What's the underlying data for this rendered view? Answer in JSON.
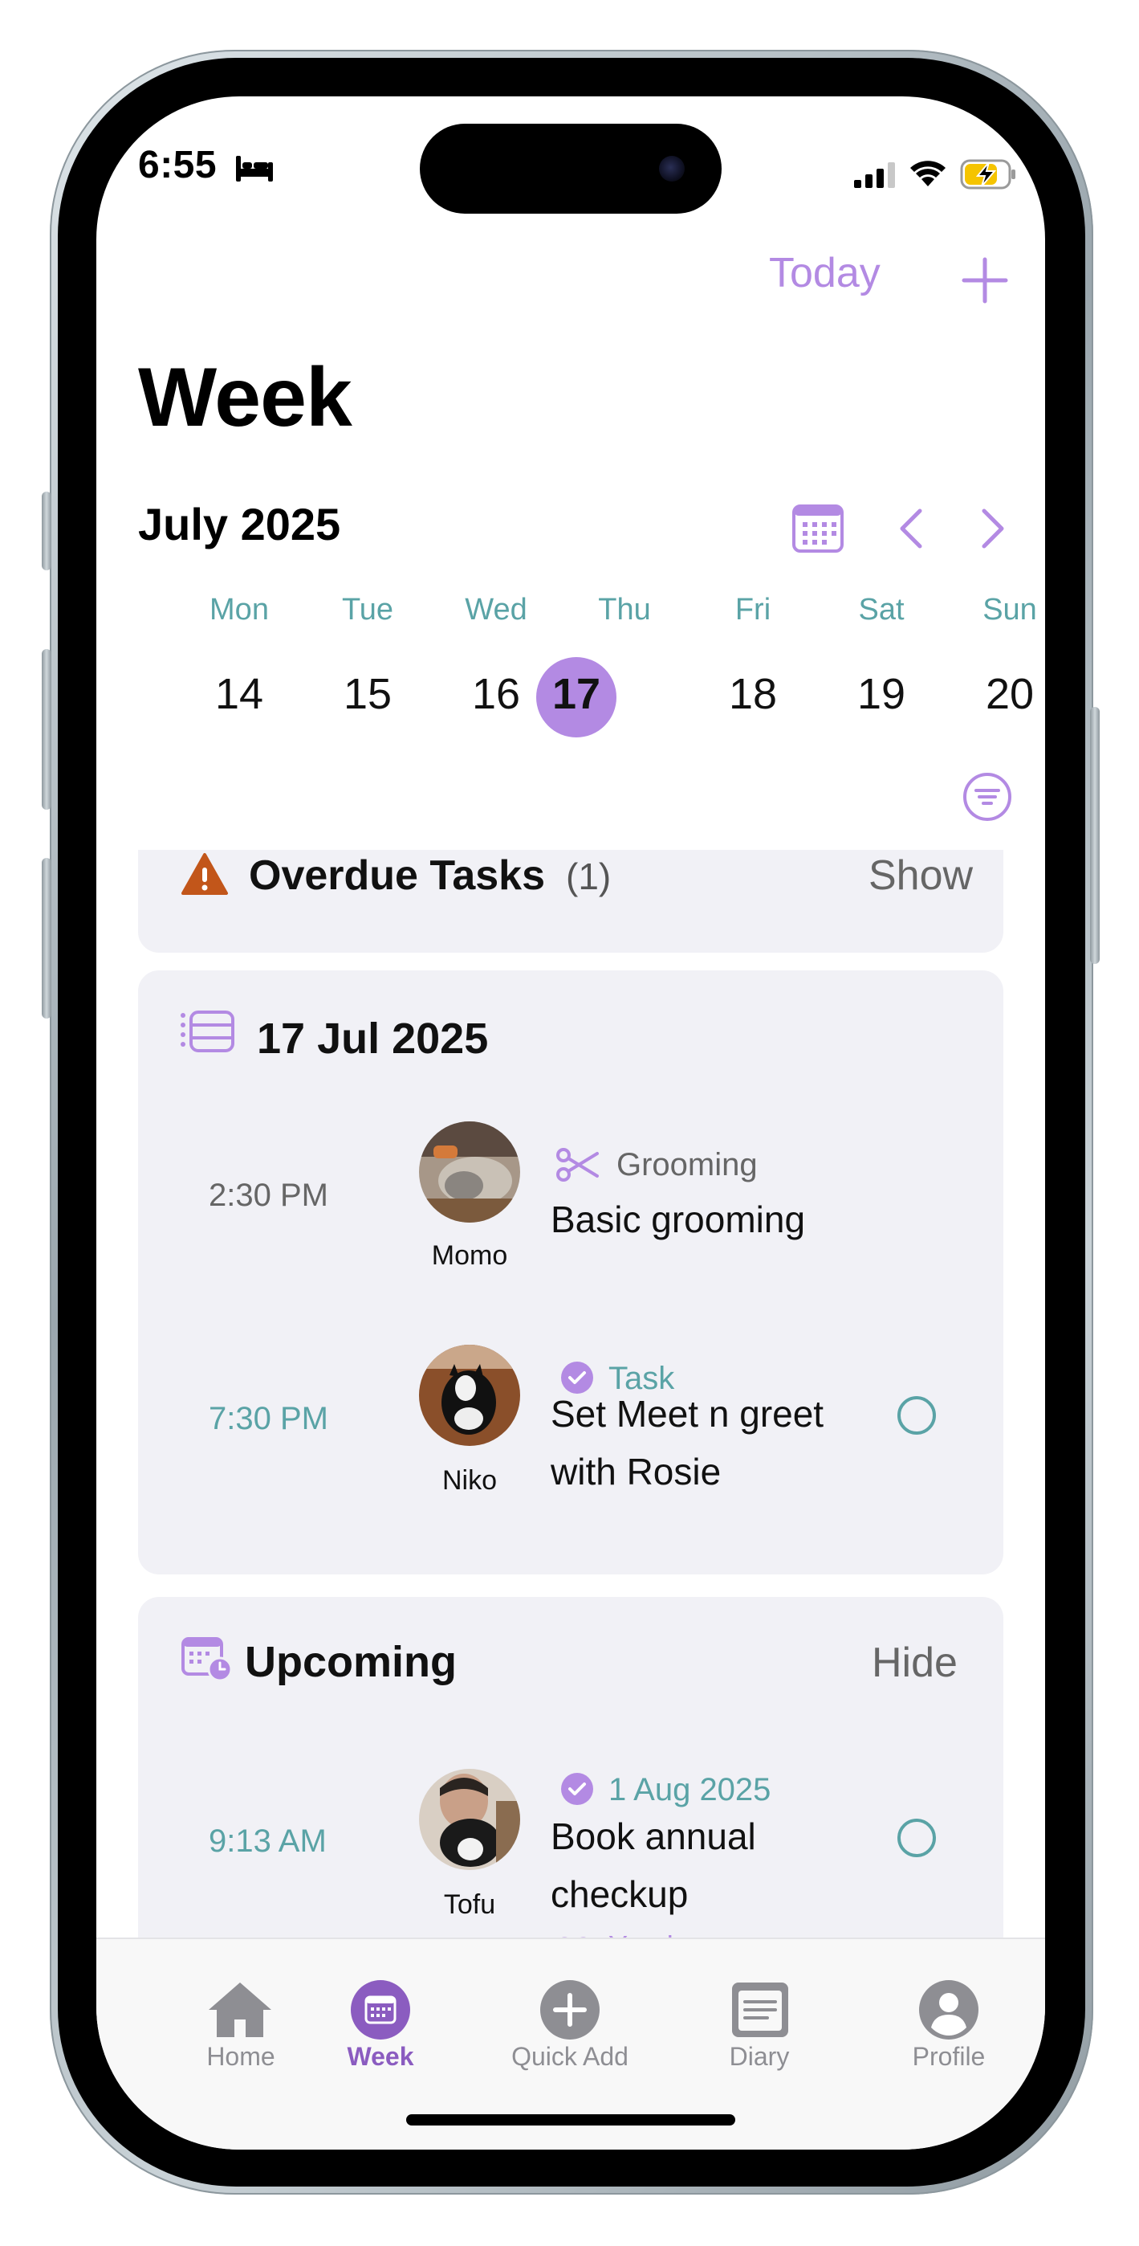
{
  "status_bar": {
    "time": "6:55"
  },
  "nav": {
    "today_label": "Today"
  },
  "page": {
    "title": "Week"
  },
  "calendar": {
    "month": "July 2025",
    "days": [
      {
        "weekday": "Mon",
        "date": "14"
      },
      {
        "weekday": "Tue",
        "date": "15"
      },
      {
        "weekday": "Wed",
        "date": "16"
      },
      {
        "weekday": "Thu",
        "date": "17"
      },
      {
        "weekday": "Fri",
        "date": "18"
      },
      {
        "weekday": "Sat",
        "date": "19"
      },
      {
        "weekday": "Sun",
        "date": "20"
      }
    ],
    "selected": "17"
  },
  "overdue": {
    "title": "Overdue Tasks",
    "count": "(1)",
    "toggle": "Show"
  },
  "day_section": {
    "date": "17 Jul 2025",
    "items": [
      {
        "time": "2:30 PM",
        "pet": "Momo",
        "category": "Grooming",
        "title": "Basic grooming"
      },
      {
        "time": "7:30 PM",
        "pet": "Niko",
        "category": "Task",
        "title_line1": "Set Meet n greet",
        "title_line2": "with Rosie"
      }
    ]
  },
  "upcoming": {
    "title": "Upcoming",
    "toggle": "Hide",
    "items": [
      {
        "time": "9:13 AM",
        "pet": "Tofu",
        "date": "1 Aug 2025",
        "title_line1": "Book annual",
        "title_line2": "checkup",
        "repeat": "Yearly"
      }
    ]
  },
  "tabbar": {
    "tabs": [
      {
        "label": "Home",
        "icon": "house-icon"
      },
      {
        "label": "Week",
        "icon": "calendar-icon",
        "active": true
      },
      {
        "label": "Quick Add",
        "icon": "plus-circle-icon"
      },
      {
        "label": "Diary",
        "icon": "notebook-icon"
      },
      {
        "label": "Profile",
        "icon": "person-circle-icon"
      }
    ]
  },
  "colors": {
    "accent": "#b38ae3",
    "teal": "#5aa3a6",
    "warning": "#c2561a",
    "card": "#f1f1f6"
  }
}
